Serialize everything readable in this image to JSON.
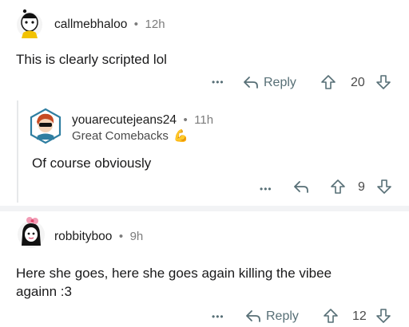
{
  "comments": [
    {
      "username": "callmebhaloo",
      "separator": "•",
      "time": "12h",
      "body": "This is clearly scripted lol",
      "more": "•••",
      "reply_label": "Reply",
      "votes": "20"
    },
    {
      "username": "youarecutejeans24",
      "separator": "•",
      "time": "11h",
      "flair": "Great Comebacks",
      "flair_emoji": "💪",
      "body": "Of course obviously",
      "more": "•••",
      "votes": "9"
    },
    {
      "username": "robbityboo",
      "separator": "•",
      "time": "9h",
      "body_line1": "Here she goes, here she goes again killing the vibee",
      "body_line2": "againn :3",
      "more": "•••",
      "reply_label": "Reply",
      "votes": "12"
    }
  ],
  "colors": {
    "action": "#576f76",
    "divider": "#f2f3f5",
    "thread_line": "#e6e8ea"
  }
}
